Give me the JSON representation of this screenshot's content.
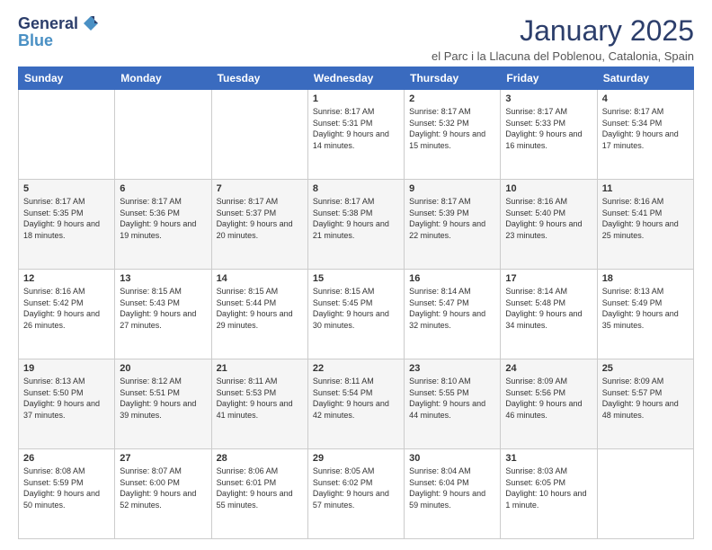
{
  "logo": {
    "general": "General",
    "blue": "Blue"
  },
  "title": "January 2025",
  "location": "el Parc i la Llacuna del Poblenou, Catalonia, Spain",
  "days_of_week": [
    "Sunday",
    "Monday",
    "Tuesday",
    "Wednesday",
    "Thursday",
    "Friday",
    "Saturday"
  ],
  "weeks": [
    [
      {
        "day": "",
        "content": ""
      },
      {
        "day": "",
        "content": ""
      },
      {
        "day": "",
        "content": ""
      },
      {
        "day": "1",
        "content": "Sunrise: 8:17 AM\nSunset: 5:31 PM\nDaylight: 9 hours and 14 minutes."
      },
      {
        "day": "2",
        "content": "Sunrise: 8:17 AM\nSunset: 5:32 PM\nDaylight: 9 hours and 15 minutes."
      },
      {
        "day": "3",
        "content": "Sunrise: 8:17 AM\nSunset: 5:33 PM\nDaylight: 9 hours and 16 minutes."
      },
      {
        "day": "4",
        "content": "Sunrise: 8:17 AM\nSunset: 5:34 PM\nDaylight: 9 hours and 17 minutes."
      }
    ],
    [
      {
        "day": "5",
        "content": "Sunrise: 8:17 AM\nSunset: 5:35 PM\nDaylight: 9 hours and 18 minutes."
      },
      {
        "day": "6",
        "content": "Sunrise: 8:17 AM\nSunset: 5:36 PM\nDaylight: 9 hours and 19 minutes."
      },
      {
        "day": "7",
        "content": "Sunrise: 8:17 AM\nSunset: 5:37 PM\nDaylight: 9 hours and 20 minutes."
      },
      {
        "day": "8",
        "content": "Sunrise: 8:17 AM\nSunset: 5:38 PM\nDaylight: 9 hours and 21 minutes."
      },
      {
        "day": "9",
        "content": "Sunrise: 8:17 AM\nSunset: 5:39 PM\nDaylight: 9 hours and 22 minutes."
      },
      {
        "day": "10",
        "content": "Sunrise: 8:16 AM\nSunset: 5:40 PM\nDaylight: 9 hours and 23 minutes."
      },
      {
        "day": "11",
        "content": "Sunrise: 8:16 AM\nSunset: 5:41 PM\nDaylight: 9 hours and 25 minutes."
      }
    ],
    [
      {
        "day": "12",
        "content": "Sunrise: 8:16 AM\nSunset: 5:42 PM\nDaylight: 9 hours and 26 minutes."
      },
      {
        "day": "13",
        "content": "Sunrise: 8:15 AM\nSunset: 5:43 PM\nDaylight: 9 hours and 27 minutes."
      },
      {
        "day": "14",
        "content": "Sunrise: 8:15 AM\nSunset: 5:44 PM\nDaylight: 9 hours and 29 minutes."
      },
      {
        "day": "15",
        "content": "Sunrise: 8:15 AM\nSunset: 5:45 PM\nDaylight: 9 hours and 30 minutes."
      },
      {
        "day": "16",
        "content": "Sunrise: 8:14 AM\nSunset: 5:47 PM\nDaylight: 9 hours and 32 minutes."
      },
      {
        "day": "17",
        "content": "Sunrise: 8:14 AM\nSunset: 5:48 PM\nDaylight: 9 hours and 34 minutes."
      },
      {
        "day": "18",
        "content": "Sunrise: 8:13 AM\nSunset: 5:49 PM\nDaylight: 9 hours and 35 minutes."
      }
    ],
    [
      {
        "day": "19",
        "content": "Sunrise: 8:13 AM\nSunset: 5:50 PM\nDaylight: 9 hours and 37 minutes."
      },
      {
        "day": "20",
        "content": "Sunrise: 8:12 AM\nSunset: 5:51 PM\nDaylight: 9 hours and 39 minutes."
      },
      {
        "day": "21",
        "content": "Sunrise: 8:11 AM\nSunset: 5:53 PM\nDaylight: 9 hours and 41 minutes."
      },
      {
        "day": "22",
        "content": "Sunrise: 8:11 AM\nSunset: 5:54 PM\nDaylight: 9 hours and 42 minutes."
      },
      {
        "day": "23",
        "content": "Sunrise: 8:10 AM\nSunset: 5:55 PM\nDaylight: 9 hours and 44 minutes."
      },
      {
        "day": "24",
        "content": "Sunrise: 8:09 AM\nSunset: 5:56 PM\nDaylight: 9 hours and 46 minutes."
      },
      {
        "day": "25",
        "content": "Sunrise: 8:09 AM\nSunset: 5:57 PM\nDaylight: 9 hours and 48 minutes."
      }
    ],
    [
      {
        "day": "26",
        "content": "Sunrise: 8:08 AM\nSunset: 5:59 PM\nDaylight: 9 hours and 50 minutes."
      },
      {
        "day": "27",
        "content": "Sunrise: 8:07 AM\nSunset: 6:00 PM\nDaylight: 9 hours and 52 minutes."
      },
      {
        "day": "28",
        "content": "Sunrise: 8:06 AM\nSunset: 6:01 PM\nDaylight: 9 hours and 55 minutes."
      },
      {
        "day": "29",
        "content": "Sunrise: 8:05 AM\nSunset: 6:02 PM\nDaylight: 9 hours and 57 minutes."
      },
      {
        "day": "30",
        "content": "Sunrise: 8:04 AM\nSunset: 6:04 PM\nDaylight: 9 hours and 59 minutes."
      },
      {
        "day": "31",
        "content": "Sunrise: 8:03 AM\nSunset: 6:05 PM\nDaylight: 10 hours and 1 minute."
      },
      {
        "day": "",
        "content": ""
      }
    ]
  ]
}
